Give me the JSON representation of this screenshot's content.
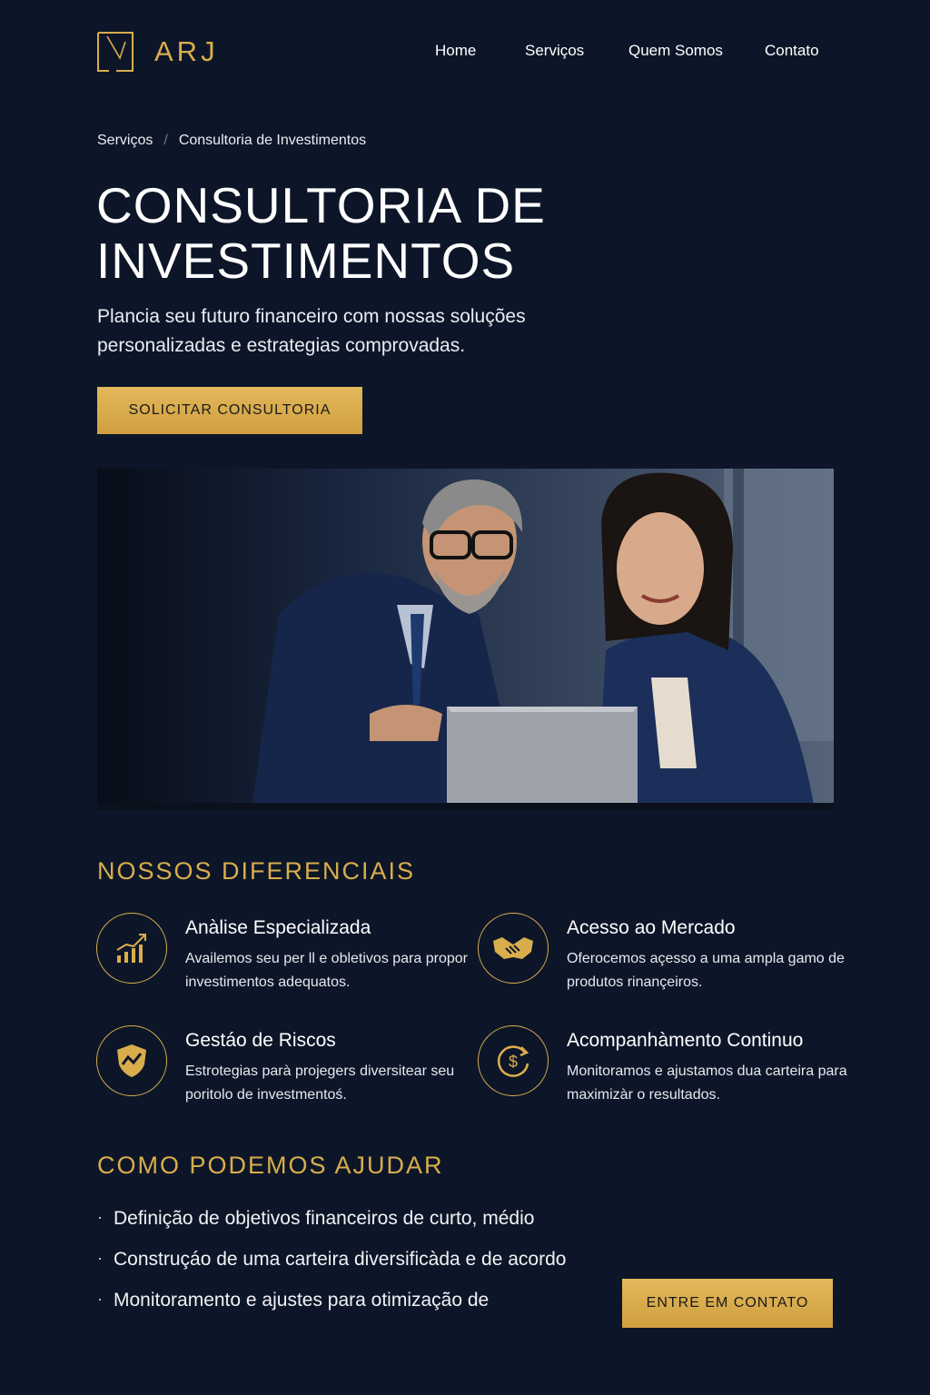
{
  "brand": {
    "name": "ARJ",
    "logo_icon": "arj-monogram-icon",
    "accent": "#d9ad4c",
    "background": "#0d1628"
  },
  "nav": {
    "items": [
      {
        "label": "Home"
      },
      {
        "label": "Serviços"
      },
      {
        "label": "Quem Somos"
      },
      {
        "label": "Contato"
      }
    ]
  },
  "breadcrumb": {
    "items": [
      "Serviços",
      "Consultoria de Investimentos"
    ],
    "separator": "/"
  },
  "hero": {
    "title": "CONSULTORIA DE INVESTIMENTOS",
    "subtitle": "Plancia seu futuro financeiro com nossas soluções personalizadas e estrategias comprovadas.",
    "cta_label": "SOLICITAR CONSULTORIA",
    "image_icon": "business-meeting-photo"
  },
  "differentials": {
    "title": "NOSSOS DIFERENCIAIS",
    "items": [
      {
        "title": "Anàlise Especializada",
        "text": "Availemos seu per ll e obletivos para propor investimentos adequatos.",
        "icon": "chart-growth-icon"
      },
      {
        "title": "Acesso ao Mercado",
        "text": "Oferocemos açesso a uma ampla gamo de produtos rinançeiros.",
        "icon": "handshake-icon"
      },
      {
        "title": "Gestáo de Riscos",
        "text": "Estrotegias parà projegers diversitear seu poritolo de investmentoś.",
        "icon": "shield-icon"
      },
      {
        "title": "Acompanhàmento Continuo",
        "text": "Monitoramos e ajustamos dua carteira para maximizàr o resultados.",
        "icon": "dollar-cycle-icon"
      }
    ]
  },
  "help": {
    "title": "COMO PODEMOS AJUDAR",
    "items": [
      "Definição de objetivos financeiros de curto, médio",
      "Construçáo de uma carteira diversificàda e de acordo",
      "Monitoramento e ajustes para otimização de"
    ],
    "cta_label": "ENTRE EM CONTATO"
  }
}
